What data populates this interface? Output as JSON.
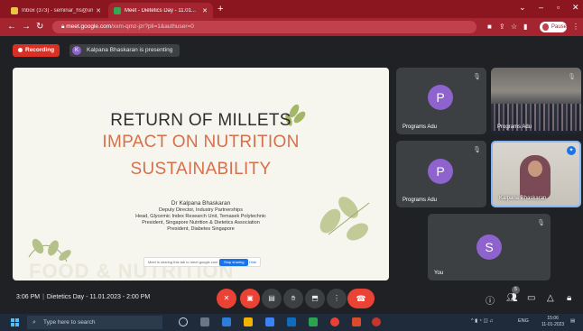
{
  "browser": {
    "tabs": [
      {
        "label": "Inbox (373) - seminar_hs@univ...",
        "fav_color": "#e8c547",
        "active": false
      },
      {
        "label": "Meet - Dietetics Day - 11.01...",
        "fav_color": "#34a853",
        "active": true
      }
    ],
    "new_tab": "+",
    "url_host": "meet.google.com",
    "url_path": "/xxm-qmz-jzr?pli=1&authuser=0",
    "profile_label": "Pause"
  },
  "meet": {
    "recording_label": "Recording",
    "presenter_initial": "K",
    "presenting_text": "Kalpana Bhaskaran is presenting",
    "slide": {
      "title": "RETURN OF MILLETS",
      "subtitle1": "IMPACT ON NUTRITION",
      "subtitle2": "SUSTAINABILITY",
      "author": "Dr Kalpana Bhaskaran",
      "roles": [
        "Deputy Director, Industry Partnerships",
        "Head, Glycemic Index Research Unit, Temasek Polytechnic",
        "President, Singapore Nutrition & Dietetics Association",
        "President, Diabetes Singapore"
      ],
      "share_prompt": "Meet is sharing this tab to meet.google.com",
      "share_stop": "Stop sharing",
      "share_hide": "Hide",
      "watermark": "FOOD & NUTRITION"
    },
    "participants": [
      {
        "name": "Programs Adu",
        "initial": "P",
        "avatar_color": "#8e63ce",
        "type": "avatar"
      },
      {
        "name": "Programs Adu",
        "type": "photo"
      },
      {
        "name": "Programs Adu",
        "initial": "P",
        "avatar_color": "#8e63ce",
        "type": "avatar"
      },
      {
        "name": "Kalpana Bhaskaran",
        "type": "webcam"
      },
      {
        "name": "You",
        "initial": "S",
        "avatar_color": "#8e63ce",
        "type": "avatar"
      }
    ],
    "time": "3:06 PM",
    "meeting_title": "Dietetics Day - 11.01.2023 - 2:00 PM",
    "people_count": "5"
  },
  "taskbar": {
    "search_placeholder": "Type here to search",
    "lang": "ENG",
    "time": "15:06",
    "date": "11-01-2023"
  },
  "colors": {
    "browser_accent": "#a42430",
    "meet_bg": "#202124",
    "danger": "#ea4335",
    "slide_accent": "#d6704c"
  }
}
